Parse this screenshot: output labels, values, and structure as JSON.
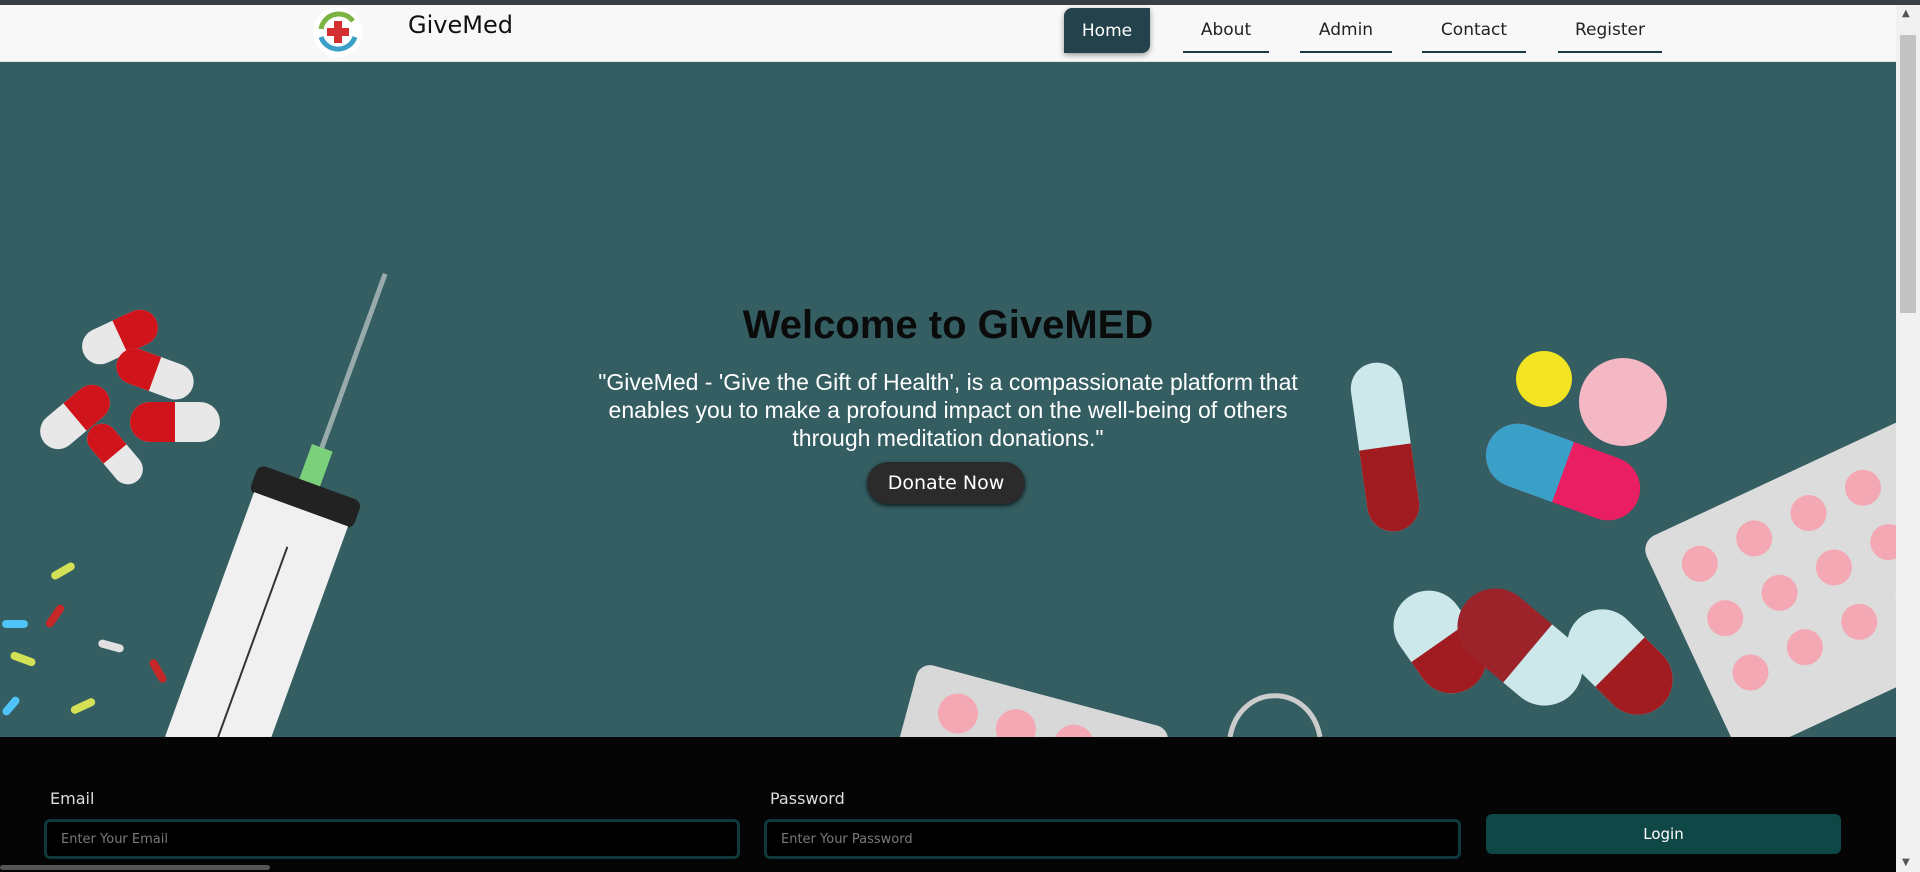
{
  "brand": {
    "name": "GiveMed",
    "logo_icon": "medical-cross-logo-icon"
  },
  "nav": {
    "items": [
      "Home",
      "About",
      "Admin",
      "Contact",
      "Register"
    ],
    "active": "Home"
  },
  "hero": {
    "title": "Welcome to GiveMED",
    "description": "\"GiveMed - 'Give the Gift of Health', is a compassionate platform that enables you to make a profound impact on the well-being of others through meditation donations.\"",
    "cta_label": "Donate Now",
    "background_color": "#345e62"
  },
  "login_form": {
    "email_label": "Email",
    "email_placeholder": "Enter Your Email",
    "password_label": "Password",
    "password_placeholder": "Enter Your Password",
    "login_label": "Login"
  },
  "colors": {
    "accent": "#23424b",
    "login_button": "#0f4646",
    "footer": "#050505"
  }
}
